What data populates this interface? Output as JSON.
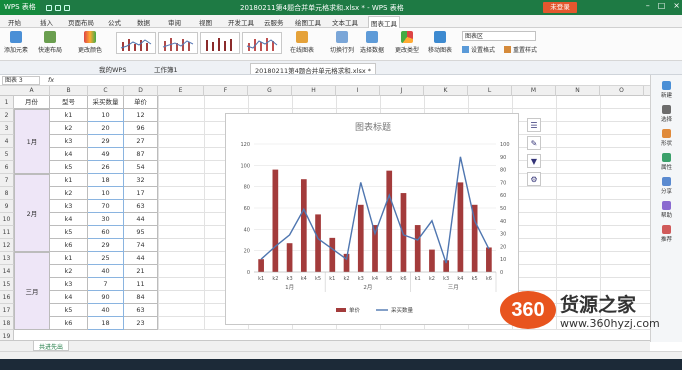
{
  "app": {
    "logo": "WPS 表格",
    "window_title": "20180211第4题合并单元格求和.xlsx * - WPS 表格",
    "login": "未登录"
  },
  "tabs": [
    "开始",
    "插入",
    "页面布局",
    "公式",
    "数据",
    "审阅",
    "视图",
    "开发工具",
    "云服务",
    "绘图工具",
    "文本工具",
    "图表工具"
  ],
  "ribbon": {
    "add_element": "添加元素",
    "quick_layout": "快速布局",
    "change_color": "更改颜色",
    "switch_row_col": "切换行列",
    "select_data": "选择数据",
    "change_type": "更改类型",
    "move_chart": "移动图表",
    "chart_area_select": "图表区",
    "set_format": "设置格式",
    "reset_style": "重置样式",
    "online_chart": "在线图表"
  },
  "doc_tabs": [
    "我的WPS",
    "工作簿1",
    "20180211第4题合并单元格求和.xlsx *"
  ],
  "formula_bar": {
    "name_box": "图表 3",
    "fx": "fx"
  },
  "columns": [
    "A",
    "B",
    "C",
    "D",
    "E",
    "F",
    "G",
    "H",
    "I",
    "J",
    "K",
    "L",
    "M",
    "N",
    "O"
  ],
  "rows": [
    "1",
    "2",
    "3",
    "4",
    "5",
    "6",
    "7",
    "8",
    "9",
    "10",
    "11",
    "12",
    "13",
    "14",
    "15",
    "16",
    "17",
    "18",
    "19"
  ],
  "table": {
    "headers": [
      "月份",
      "型号",
      "采买数量",
      "单价"
    ],
    "months": [
      "1月",
      "2月",
      "三月"
    ],
    "models": [
      "k1",
      "k2",
      "k3",
      "k4",
      "k5",
      "k1",
      "k2",
      "k3",
      "k4",
      "k5",
      "k6",
      "k1",
      "k2",
      "k3",
      "k4",
      "k5",
      "k6"
    ],
    "qty": [
      "10",
      "20",
      "29",
      "49",
      "26",
      "18",
      "10",
      "70",
      "30",
      "60",
      "29",
      "25",
      "40",
      "7",
      "90",
      "40",
      "18"
    ],
    "price": [
      "12",
      "96",
      "27",
      "87",
      "54",
      "32",
      "17",
      "63",
      "44",
      "95",
      "74",
      "44",
      "21",
      "11",
      "84",
      "63",
      "23"
    ]
  },
  "chart_data": {
    "type": "bar",
    "title": "图表标题",
    "categories": [
      "k1",
      "k2",
      "k3",
      "k4",
      "k5",
      "k1",
      "k2",
      "k3",
      "k4",
      "k5",
      "k6",
      "k1",
      "k2",
      "k3",
      "k4",
      "k5",
      "k6"
    ],
    "groups": [
      "1月",
      "2月",
      "三月"
    ],
    "series": [
      {
        "name": "单价",
        "type": "bar",
        "axis": "left",
        "values": [
          12,
          96,
          27,
          87,
          54,
          32,
          17,
          63,
          44,
          95,
          74,
          44,
          21,
          11,
          84,
          63,
          23
        ],
        "color": "#a33b3b"
      },
      {
        "name": "采买数量",
        "type": "line",
        "axis": "right",
        "values": [
          10,
          20,
          29,
          49,
          26,
          18,
          10,
          70,
          30,
          60,
          29,
          25,
          40,
          7,
          90,
          40,
          18
        ],
        "color": "#4f76b0"
      }
    ],
    "ylim_left": [
      0,
      120
    ],
    "ylim_right": [
      0,
      100
    ],
    "yticks_left": [
      "0",
      "20",
      "40",
      "60",
      "80",
      "100",
      "120"
    ],
    "yticks_right": [
      "0",
      "10",
      "20",
      "30",
      "40",
      "50",
      "60",
      "70",
      "80",
      "90",
      "100"
    ],
    "legend": "bottom",
    "grid": true
  },
  "right_panel": [
    "新建",
    "选择",
    "形状",
    "属性",
    "分享",
    "帮助",
    "推荐"
  ],
  "sheet": {
    "tab": "共进先出"
  },
  "watermark": {
    "logo": "360",
    "name": "货源之家",
    "url": "www.360hyzj.com"
  }
}
